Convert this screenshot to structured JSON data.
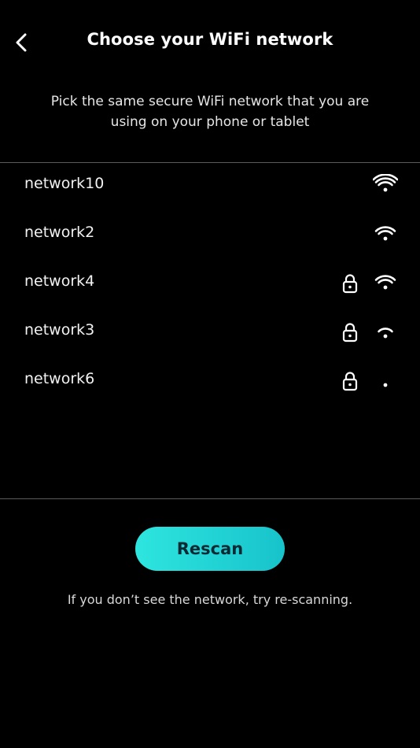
{
  "header": {
    "title": "Choose your WiFi network",
    "back_icon": "chevron-left-icon"
  },
  "subtitle": "Pick the same secure WiFi network that you are using on your phone or tablet",
  "networks": [
    {
      "name": "network10",
      "secured": false,
      "signal_bars": 4
    },
    {
      "name": "network2",
      "secured": false,
      "signal_bars": 3
    },
    {
      "name": "network4",
      "secured": true,
      "signal_bars": 3
    },
    {
      "name": "network3",
      "secured": true,
      "signal_bars": 2
    },
    {
      "name": "network6",
      "secured": true,
      "signal_bars": 1
    }
  ],
  "rescan": {
    "label": "Rescan",
    "color_start": "#2ee5df",
    "color_end": "#17c3cb"
  },
  "hint": "If you don’t see the network, try re-scanning."
}
